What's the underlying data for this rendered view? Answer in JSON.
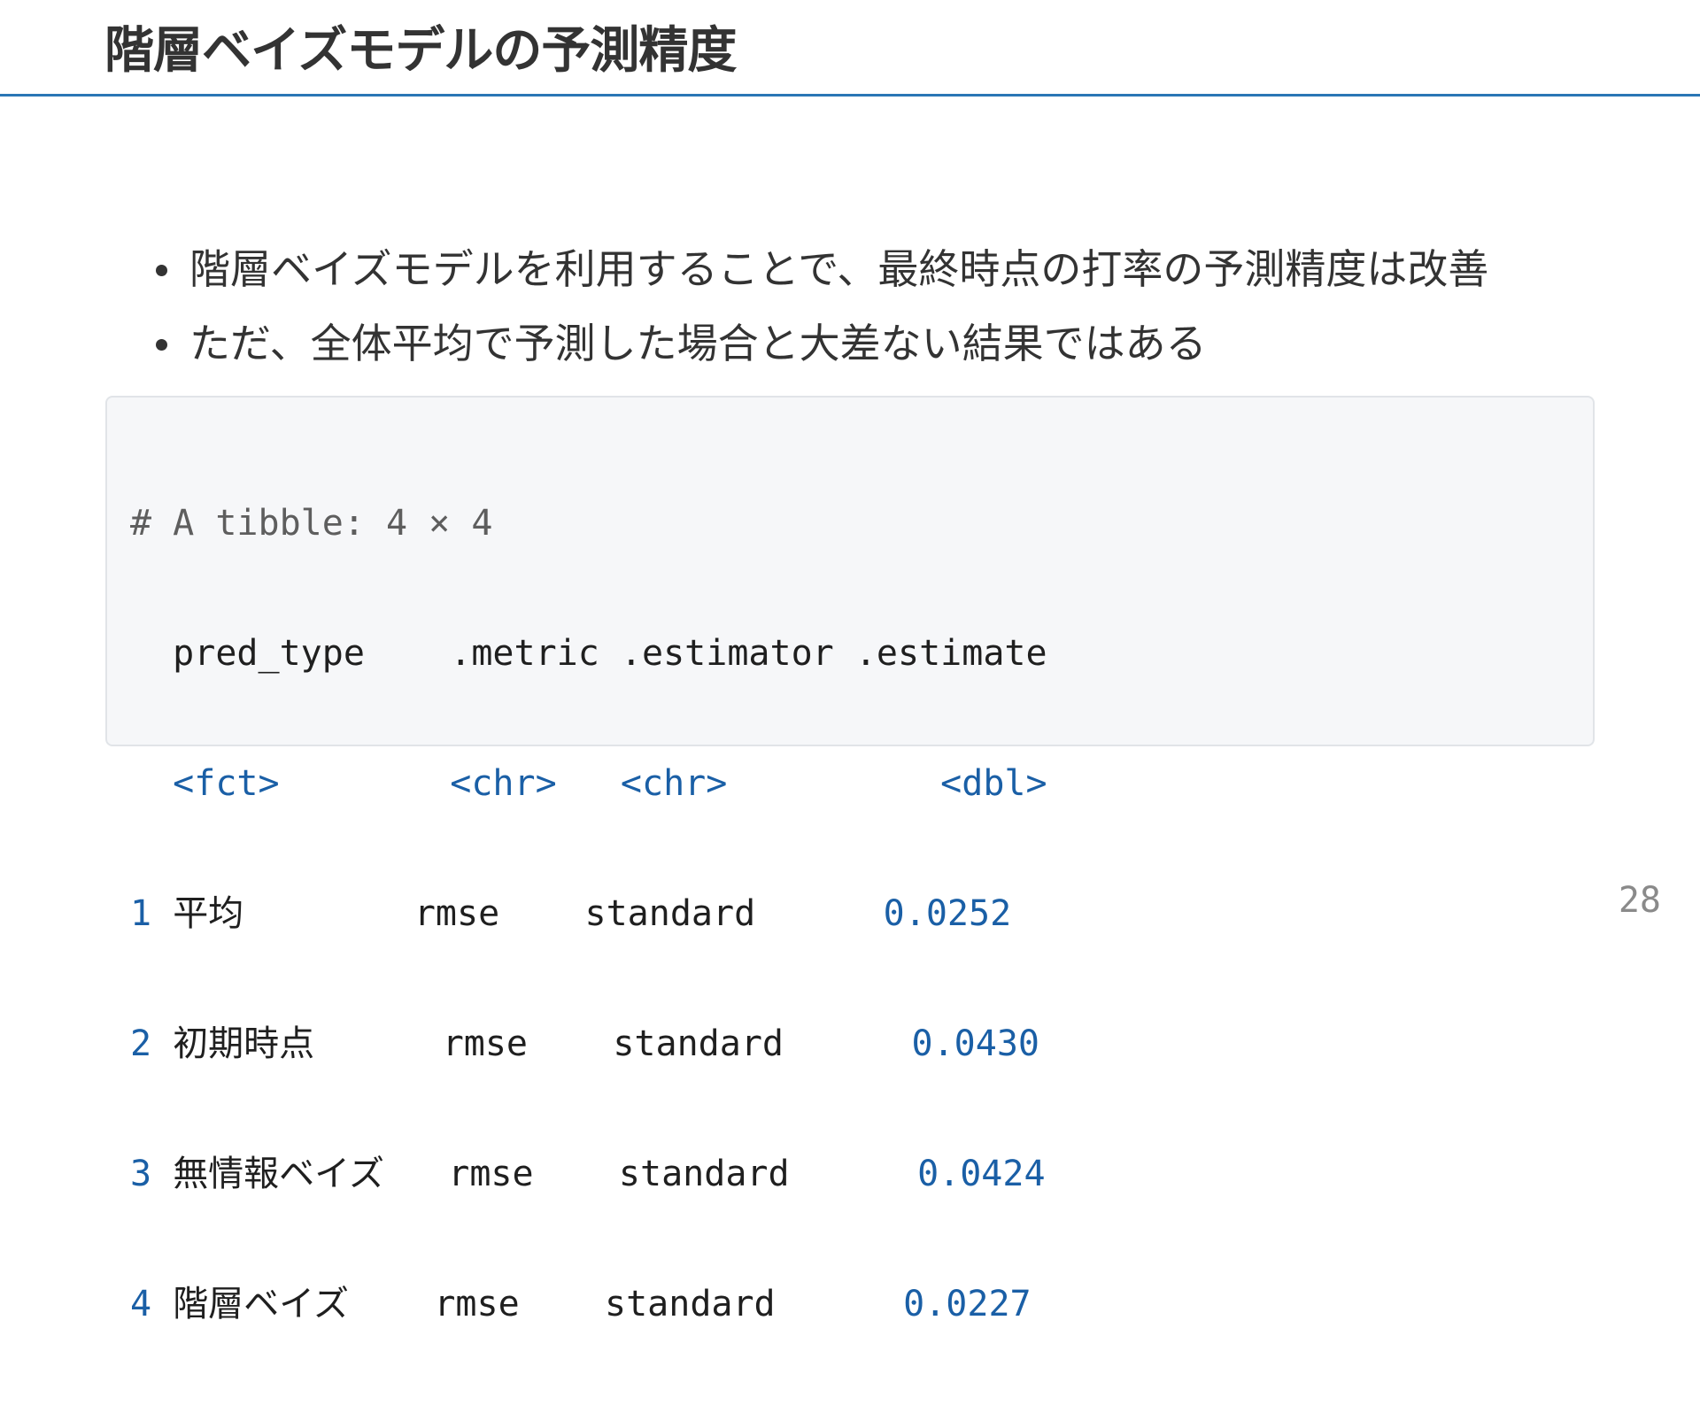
{
  "slide": {
    "title": "階層ベイズモデルの予測精度",
    "page_number": "28"
  },
  "bullets": [
    "階層ベイズモデルを利用することで、最終時点の打率の予測精度は改善",
    "ただ、全体平均で予測した場合と大差ない結果ではある"
  ],
  "code": {
    "comment": "# A tibble: 4 × 4",
    "header": {
      "pred_type": "pred_type",
      "metric": ".metric",
      "estimator": ".estimator",
      "estimate": ".estimate"
    },
    "types": {
      "pred_type": "<fct>",
      "metric": "<chr>",
      "estimator": "<chr>",
      "estimate": "<dbl>"
    },
    "rows": [
      {
        "n": "1",
        "pred_type": "平均",
        "metric": "rmse",
        "estimator": "standard",
        "estimate": "0.0252"
      },
      {
        "n": "2",
        "pred_type": "初期時点",
        "metric": "rmse",
        "estimator": "standard",
        "estimate": "0.0430"
      },
      {
        "n": "3",
        "pred_type": "無情報ベイズ",
        "metric": "rmse",
        "estimator": "standard",
        "estimate": "0.0424"
      },
      {
        "n": "4",
        "pred_type": "階層ベイズ",
        "metric": "rmse",
        "estimator": "standard",
        "estimate": "0.0227"
      }
    ]
  },
  "colors": {
    "accent_rule": "#2a76b5",
    "code_type": "#1a5fa6",
    "code_background": "#f6f7f9"
  }
}
